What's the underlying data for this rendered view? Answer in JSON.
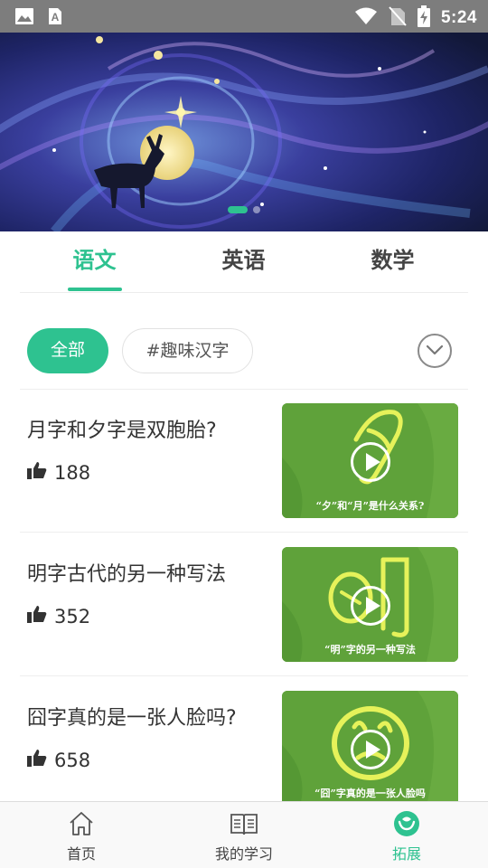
{
  "status_bar": {
    "time": "5:24",
    "icons": [
      "image-icon",
      "text-a-icon",
      "wifi-icon",
      "no-sim-icon",
      "battery-charging-icon"
    ]
  },
  "banner": {
    "slides": 2,
    "active_slide": 0
  },
  "tabs": [
    {
      "label": "语文",
      "active": true
    },
    {
      "label": "英语",
      "active": false
    },
    {
      "label": "数学",
      "active": false
    }
  ],
  "filters": {
    "all_label": "全部",
    "tag_label": "#趣味汉字",
    "expand_icon": "chevron-down-circle-icon"
  },
  "items": [
    {
      "title": "月字和夕字是双胞胎?",
      "likes": "188",
      "caption": "“夕”和“月”是什么关系?",
      "glyph": "月"
    },
    {
      "title": "明字古代的另一种写法",
      "likes": "352",
      "caption": "“明”字的另一种写法",
      "glyph": "明"
    },
    {
      "title": "囧字真的是一张人脸吗?",
      "likes": "658",
      "caption": "“囧”字真的是一张人脸吗",
      "glyph": "囧"
    }
  ],
  "bottom_nav": [
    {
      "label": "首页",
      "icon": "home-icon",
      "active": false
    },
    {
      "label": "我的学习",
      "icon": "book-icon",
      "active": false
    },
    {
      "label": "拓展",
      "icon": "expand-leaf-icon",
      "active": true
    }
  ],
  "colors": {
    "accent": "#2ec290",
    "status_bar": "#7d7d7d",
    "thumbnail_green": "#5fa23a",
    "glyph_yellow": "#e6f25a"
  }
}
